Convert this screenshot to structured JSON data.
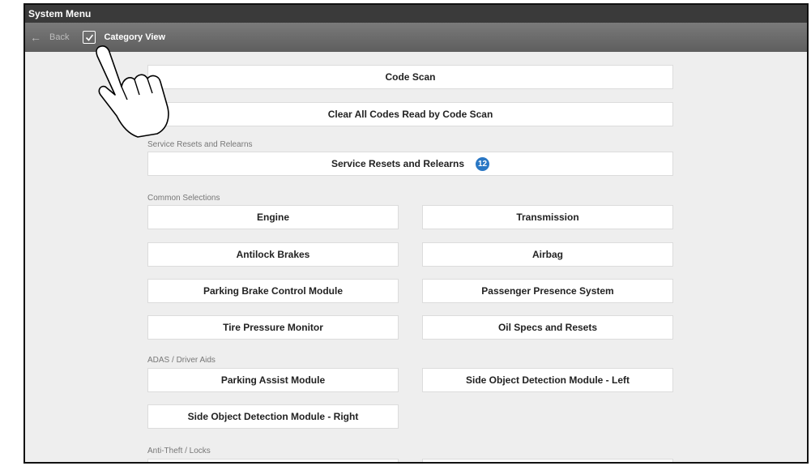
{
  "window": {
    "title": "System Menu"
  },
  "toolbar": {
    "back_label": "Back",
    "category_view_label": "Category View"
  },
  "top_buttons": {
    "code_scan": "Code Scan",
    "clear_codes": "Clear All Codes Read by Code Scan"
  },
  "service": {
    "heading": "Service Resets and Relearns",
    "button_label": "Service Resets and Relearns",
    "badge_count": "12"
  },
  "common": {
    "heading": "Common Selections",
    "items": [
      "Engine",
      "Transmission",
      "Antilock Brakes",
      "Airbag",
      "Parking Brake Control Module",
      "Passenger Presence System",
      "Tire Pressure Monitor",
      "Oil Specs and Resets"
    ]
  },
  "adas": {
    "heading": "ADAS / Driver Aids",
    "items": [
      "Parking Assist Module",
      "Side Object Detection Module - Left",
      "Side Object Detection Module - Right"
    ]
  },
  "antitheft": {
    "heading": "Anti-Theft / Locks"
  },
  "colors": {
    "badge": "#2a77c4",
    "titlebar": "#3a3a3a",
    "toolbar": "#666666"
  },
  "icons": {
    "back": "back-arrow-icon",
    "checkbox": "checkbox-checked-icon",
    "badge": "count-badge"
  }
}
